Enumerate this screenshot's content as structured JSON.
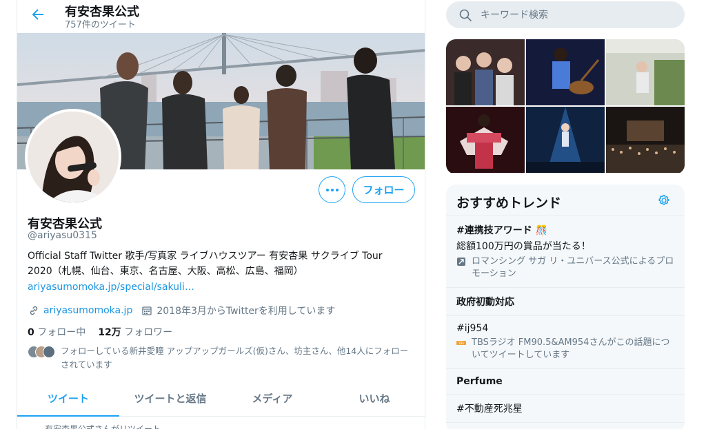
{
  "header": {
    "title": "有安杏果公式",
    "tweet_count": "757件のツイート"
  },
  "profile": {
    "name": "有安杏果公式",
    "handle": "@ariyasu0315",
    "bio": "Official Staff Twitter 歌手/写真家 ライブハウスツアー 有安杏果 サクライブ Tour 2020（札幌、仙台、東京、名古屋、大阪、高松、広島、福岡）",
    "bio_link": "ariyasumomoka.jp/special/sakuli…",
    "website": "ariyasumomoka.jp",
    "joined": "2018年3月からTwitterを利用しています",
    "following_count": "0",
    "following_label": "フォロー中",
    "followers_count": "12万",
    "followers_label": "フォロワー",
    "followed_by": "フォローしている新井愛瞳 アップアップガールズ(仮)さん、坊主さん、他14人にフォローされています",
    "follow_button": "フォロー"
  },
  "tabs": [
    {
      "label": "ツイート",
      "active": true
    },
    {
      "label": "ツイートと返信",
      "active": false
    },
    {
      "label": "メディア",
      "active": false
    },
    {
      "label": "いいね",
      "active": false
    }
  ],
  "retweet_hint": "有安杏果公式さんがリツイート",
  "search": {
    "placeholder": "キーワード検索"
  },
  "trends": {
    "title": "おすすめトレンド",
    "items": [
      {
        "name": "#連携技アワード",
        "desc": "総額100万円の賞品が当たる！",
        "sub": "ロマンシング サガ リ・ユニバース公式によるプロモーション"
      },
      {
        "name": "政府初動対応"
      },
      {
        "name": "#ij954",
        "sub": "TBSラジオ FM90.5&AM954さんがこの話題についてツイートしています"
      },
      {
        "name": "Perfume"
      },
      {
        "name": "#不動産死兆星"
      }
    ]
  },
  "colors": {
    "accent": "#1da1f2",
    "link": "#1b95e0",
    "muted": "#657786",
    "text": "#14171a",
    "divider": "#e6ecf0",
    "panel": "#f5f8fa"
  }
}
